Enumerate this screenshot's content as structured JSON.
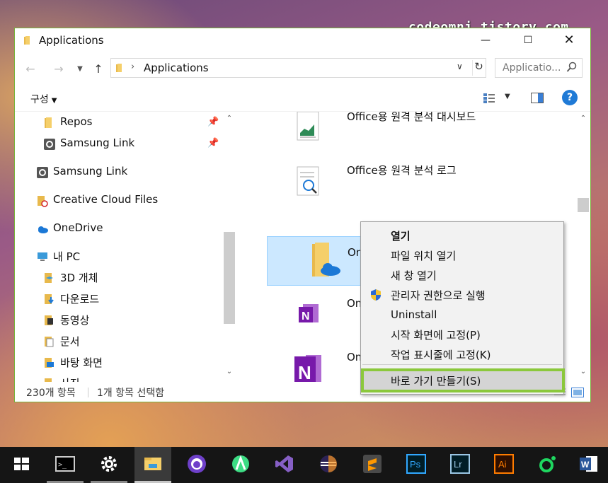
{
  "watermark": "codeomni.tistory.com",
  "window": {
    "title": "Applications",
    "address": {
      "path": "Applications"
    },
    "search": {
      "placeholder": "Applicatio..."
    },
    "toolbar": {
      "organize": "구성"
    },
    "nav_items": [
      {
        "label": "Repos",
        "icon": "folder-icon",
        "pinned": true
      },
      {
        "label": "Samsung Link",
        "icon": "samsung-link-icon",
        "pinned": true
      },
      {
        "label": "Samsung Link",
        "icon": "samsung-link-icon",
        "pinned": false
      },
      {
        "label": "Creative Cloud Files",
        "icon": "creative-cloud-icon",
        "pinned": false
      },
      {
        "label": "OneDrive",
        "icon": "onedrive-icon",
        "pinned": false
      },
      {
        "label": "내 PC",
        "icon": "pc-icon",
        "pinned": false
      },
      {
        "label": "3D 개체",
        "icon": "3d-objects-icon",
        "pinned": false
      },
      {
        "label": "다운로드",
        "icon": "downloads-icon",
        "pinned": false
      },
      {
        "label": "동영상",
        "icon": "videos-icon",
        "pinned": false
      },
      {
        "label": "문서",
        "icon": "documents-icon",
        "pinned": false
      },
      {
        "label": "바탕 화면",
        "icon": "desktop-icon",
        "pinned": false
      },
      {
        "label": "사진",
        "icon": "pictures-icon",
        "pinned": false
      }
    ],
    "files": [
      {
        "name": "Office용 원격 분석 대시보드",
        "icon": "dashboard-doc-icon",
        "selected": false
      },
      {
        "name": "Office용 원격 분석 로그",
        "icon": "log-doc-icon",
        "selected": false
      },
      {
        "name": "OneD",
        "icon": "onedrive-folder-icon",
        "selected": true
      },
      {
        "name": "OneN",
        "icon": "onenote-icon",
        "selected": false
      },
      {
        "name": "OneN",
        "icon": "onenote-large-icon",
        "selected": false
      }
    ],
    "status": {
      "count": "230개 항목",
      "selection": "1개 항목 선택함"
    }
  },
  "context_menu": {
    "items": [
      {
        "label": "열기",
        "bold": true
      },
      {
        "label": "파일 위치 열기",
        "bold": false
      },
      {
        "label": "새 창 열기",
        "bold": false
      },
      {
        "label": "관리자 권한으로 실행",
        "bold": false,
        "icon": "uac-shield-icon"
      },
      {
        "label": "Uninstall",
        "bold": false
      },
      {
        "label": "시작 화면에 고정(P)",
        "bold": false
      },
      {
        "label": "작업 표시줄에 고정(K)",
        "bold": false
      },
      {
        "label": "바로 가기 만들기(S)",
        "bold": false,
        "highlighted": true
      }
    ]
  },
  "taskbar": {
    "apps": [
      "start-icon",
      "terminal-icon",
      "settings-icon",
      "file-explorer-icon",
      "github-desktop-icon",
      "android-studio-icon",
      "visual-studio-icon",
      "eclipse-icon",
      "sublime-text-icon",
      "photoshop-icon",
      "lightroom-icon",
      "illustrator-icon",
      "spotify-icon",
      "word-icon"
    ],
    "labels": {
      "photoshop": "Ps",
      "lightroom": "Lr",
      "illustrator": "Ai",
      "word": "W"
    }
  },
  "colors": {
    "accent_green": "#8bc83c",
    "selection_bg": "#cce8ff",
    "help_blue": "#1f7ad6"
  }
}
